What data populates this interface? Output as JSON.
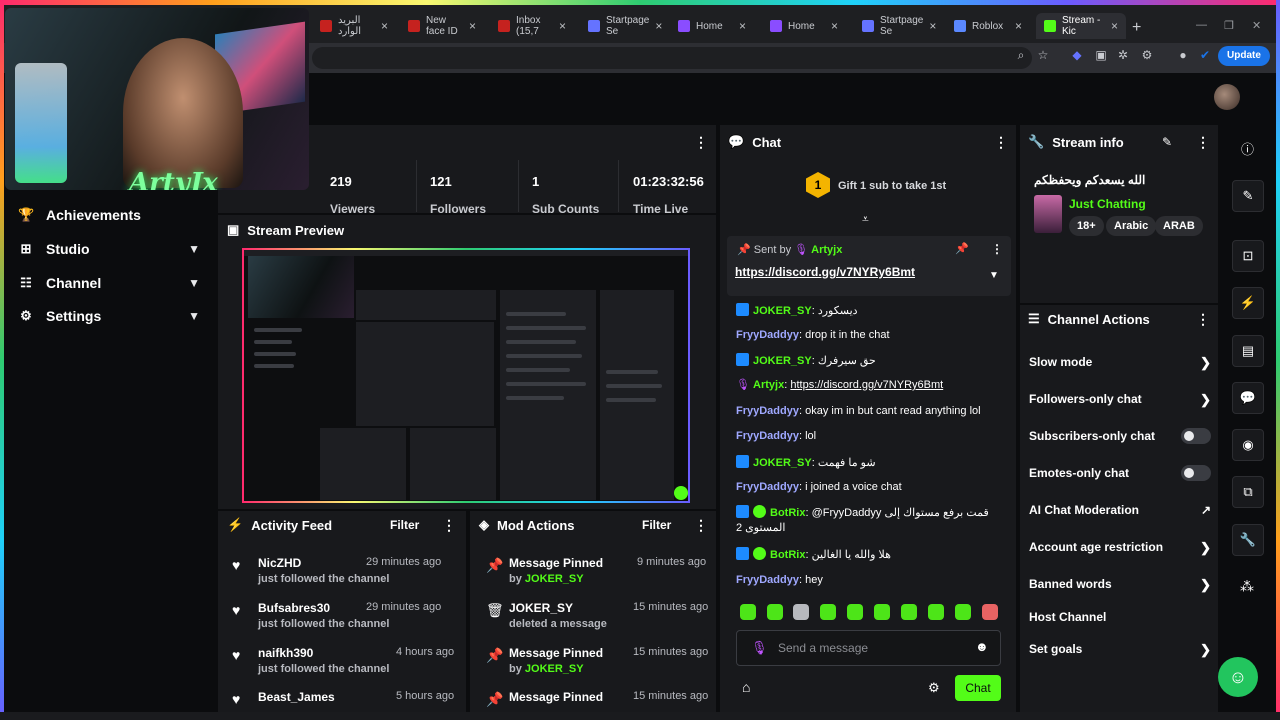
{
  "browser": {
    "tabs": [
      {
        "label": "البريد الوارد",
        "color": "#c5221f"
      },
      {
        "label": "New face ID",
        "color": "#c5221f"
      },
      {
        "label": "Inbox (15,7",
        "color": "#c5221f"
      },
      {
        "label": "Startpage Se",
        "color": "#6573ff"
      },
      {
        "label": "Home",
        "color": "#8a4dff"
      },
      {
        "label": "Home",
        "color": "#8a4dff"
      },
      {
        "label": "Startpage Se",
        "color": "#6573ff"
      },
      {
        "label": "Roblox",
        "color": "#5a88ff"
      },
      {
        "label": "Stream - Kic",
        "color": "#53fc18"
      }
    ],
    "update_label": "Update"
  },
  "webcam": {
    "logo": "ArtyJx"
  },
  "nav": {
    "items": [
      {
        "label": "Achievements",
        "icon": "trophy-icon"
      },
      {
        "label": "Studio",
        "icon": "studio-icon"
      },
      {
        "label": "Channel",
        "icon": "channel-icon"
      },
      {
        "label": "Settings",
        "icon": "gear-icon"
      }
    ]
  },
  "stats": [
    {
      "value": "219",
      "label": "Viewers"
    },
    {
      "value": "121",
      "label": "Followers"
    },
    {
      "value": "1",
      "label": "Sub Counts"
    },
    {
      "value": "01:23:32:56",
      "label": "Time Live"
    }
  ],
  "preview": {
    "title": "Stream Preview"
  },
  "activity": {
    "title": "Activity Feed",
    "filter": "Filter",
    "items": [
      {
        "name": "NicZHD",
        "sub": "just followed the channel",
        "time": "29 minutes ago"
      },
      {
        "name": "Bufsabres30",
        "sub": "just followed the channel",
        "time": "29 minutes ago"
      },
      {
        "name": "naifkh390",
        "sub": "just followed the channel",
        "time": "4 hours ago"
      },
      {
        "name": "Beast_James",
        "sub": "",
        "time": "5 hours ago"
      }
    ]
  },
  "mod": {
    "title": "Mod Actions",
    "filter": "Filter",
    "items": [
      {
        "name": "Message Pinned",
        "by": "by",
        "byname": "JOKER_SY",
        "time": "9 minutes ago",
        "icon": "pin-icon"
      },
      {
        "name": "JOKER_SY",
        "by": "deleted a message",
        "byname": "",
        "time": "15 minutes ago",
        "icon": "trash-icon"
      },
      {
        "name": "Message Pinned",
        "by": "by",
        "byname": "JOKER_SY",
        "time": "15 minutes ago",
        "icon": "pin-icon"
      },
      {
        "name": "Message Pinned",
        "by": "",
        "byname": "",
        "time": "15 minutes ago",
        "icon": "pin-icon"
      }
    ]
  },
  "chat": {
    "title": "Chat",
    "gift_count": "1",
    "gift_text": "Gift 1 sub to take 1st",
    "pinned_sent_by": "Sent by",
    "pinned_user": "Artyjx",
    "pinned_link": "https://discord.gg/v7NYRy6Bmt",
    "messages": [
      {
        "user": "JOKER_SY",
        "text": "ديسكورد",
        "color": "#53fc18"
      },
      {
        "user": "FryyDaddyy",
        "text": "drop it in the chat",
        "color": "#9fa8ff"
      },
      {
        "user": "JOKER_SY",
        "text": "حق سيرفرك",
        "color": "#53fc18"
      },
      {
        "user": "Artyjx",
        "text": "https://discord.gg/v7NYRy6Bmt",
        "color": "#53fc18"
      },
      {
        "user": "FryyDaddyy",
        "text": "okay im in but cant read anything lol",
        "color": "#9fa8ff"
      },
      {
        "user": "FryyDaddyy",
        "text": "lol",
        "color": "#9fa8ff"
      },
      {
        "user": "JOKER_SY",
        "text": "شو ما فهمت",
        "color": "#53fc18"
      },
      {
        "user": "FryyDaddyy",
        "text": "i joined a voice chat",
        "color": "#9fa8ff"
      },
      {
        "user": "BotRix",
        "text": "@FryyDaddyy قمت برفع مستواك إلى المستوى 2",
        "color": "#53fc18"
      },
      {
        "user": "BotRix",
        "text": "هلا والله يا الغالين",
        "color": "#53fc18"
      },
      {
        "user": "FryyDaddyy",
        "text": "hey",
        "color": "#9fa8ff"
      }
    ],
    "placeholder": "Send a message",
    "send_label": "Chat"
  },
  "stream_info": {
    "title": "Stream info",
    "stream_title": "الله يسعدكم ويحفظكم",
    "category": "Just Chatting",
    "tags": [
      "18+",
      "Arabic",
      "ARAB"
    ]
  },
  "channel_actions": {
    "title": "Channel Actions",
    "items": [
      {
        "label": "Slow mode",
        "control": "arrow"
      },
      {
        "label": "Followers-only chat",
        "control": "arrow"
      },
      {
        "label": "Subscribers-only chat",
        "control": "toggle"
      },
      {
        "label": "Emotes-only chat",
        "control": "toggle"
      },
      {
        "label": "AI Chat Moderation",
        "control": "external"
      },
      {
        "label": "Account age restriction",
        "control": "arrow"
      },
      {
        "label": "Banned words",
        "control": "arrow"
      },
      {
        "label": "Host Channel",
        "control": "none"
      },
      {
        "label": "Set goals",
        "control": "arrow"
      }
    ]
  }
}
